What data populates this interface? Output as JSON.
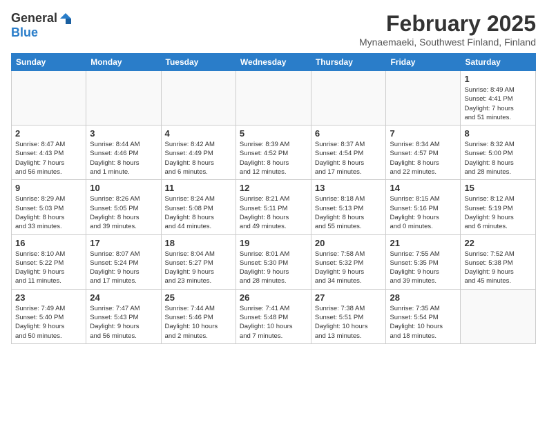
{
  "header": {
    "logo_general": "General",
    "logo_blue": "Blue",
    "month_title": "February 2025",
    "location": "Mynaemaeki, Southwest Finland, Finland"
  },
  "days_of_week": [
    "Sunday",
    "Monday",
    "Tuesday",
    "Wednesday",
    "Thursday",
    "Friday",
    "Saturday"
  ],
  "weeks": [
    [
      {
        "day": "",
        "detail": ""
      },
      {
        "day": "",
        "detail": ""
      },
      {
        "day": "",
        "detail": ""
      },
      {
        "day": "",
        "detail": ""
      },
      {
        "day": "",
        "detail": ""
      },
      {
        "day": "",
        "detail": ""
      },
      {
        "day": "1",
        "detail": "Sunrise: 8:49 AM\nSunset: 4:41 PM\nDaylight: 7 hours\nand 51 minutes."
      }
    ],
    [
      {
        "day": "2",
        "detail": "Sunrise: 8:47 AM\nSunset: 4:43 PM\nDaylight: 7 hours\nand 56 minutes."
      },
      {
        "day": "3",
        "detail": "Sunrise: 8:44 AM\nSunset: 4:46 PM\nDaylight: 8 hours\nand 1 minute."
      },
      {
        "day": "4",
        "detail": "Sunrise: 8:42 AM\nSunset: 4:49 PM\nDaylight: 8 hours\nand 6 minutes."
      },
      {
        "day": "5",
        "detail": "Sunrise: 8:39 AM\nSunset: 4:52 PM\nDaylight: 8 hours\nand 12 minutes."
      },
      {
        "day": "6",
        "detail": "Sunrise: 8:37 AM\nSunset: 4:54 PM\nDaylight: 8 hours\nand 17 minutes."
      },
      {
        "day": "7",
        "detail": "Sunrise: 8:34 AM\nSunset: 4:57 PM\nDaylight: 8 hours\nand 22 minutes."
      },
      {
        "day": "8",
        "detail": "Sunrise: 8:32 AM\nSunset: 5:00 PM\nDaylight: 8 hours\nand 28 minutes."
      }
    ],
    [
      {
        "day": "9",
        "detail": "Sunrise: 8:29 AM\nSunset: 5:03 PM\nDaylight: 8 hours\nand 33 minutes."
      },
      {
        "day": "10",
        "detail": "Sunrise: 8:26 AM\nSunset: 5:05 PM\nDaylight: 8 hours\nand 39 minutes."
      },
      {
        "day": "11",
        "detail": "Sunrise: 8:24 AM\nSunset: 5:08 PM\nDaylight: 8 hours\nand 44 minutes."
      },
      {
        "day": "12",
        "detail": "Sunrise: 8:21 AM\nSunset: 5:11 PM\nDaylight: 8 hours\nand 49 minutes."
      },
      {
        "day": "13",
        "detail": "Sunrise: 8:18 AM\nSunset: 5:13 PM\nDaylight: 8 hours\nand 55 minutes."
      },
      {
        "day": "14",
        "detail": "Sunrise: 8:15 AM\nSunset: 5:16 PM\nDaylight: 9 hours\nand 0 minutes."
      },
      {
        "day": "15",
        "detail": "Sunrise: 8:12 AM\nSunset: 5:19 PM\nDaylight: 9 hours\nand 6 minutes."
      }
    ],
    [
      {
        "day": "16",
        "detail": "Sunrise: 8:10 AM\nSunset: 5:22 PM\nDaylight: 9 hours\nand 11 minutes."
      },
      {
        "day": "17",
        "detail": "Sunrise: 8:07 AM\nSunset: 5:24 PM\nDaylight: 9 hours\nand 17 minutes."
      },
      {
        "day": "18",
        "detail": "Sunrise: 8:04 AM\nSunset: 5:27 PM\nDaylight: 9 hours\nand 23 minutes."
      },
      {
        "day": "19",
        "detail": "Sunrise: 8:01 AM\nSunset: 5:30 PM\nDaylight: 9 hours\nand 28 minutes."
      },
      {
        "day": "20",
        "detail": "Sunrise: 7:58 AM\nSunset: 5:32 PM\nDaylight: 9 hours\nand 34 minutes."
      },
      {
        "day": "21",
        "detail": "Sunrise: 7:55 AM\nSunset: 5:35 PM\nDaylight: 9 hours\nand 39 minutes."
      },
      {
        "day": "22",
        "detail": "Sunrise: 7:52 AM\nSunset: 5:38 PM\nDaylight: 9 hours\nand 45 minutes."
      }
    ],
    [
      {
        "day": "23",
        "detail": "Sunrise: 7:49 AM\nSunset: 5:40 PM\nDaylight: 9 hours\nand 50 minutes."
      },
      {
        "day": "24",
        "detail": "Sunrise: 7:47 AM\nSunset: 5:43 PM\nDaylight: 9 hours\nand 56 minutes."
      },
      {
        "day": "25",
        "detail": "Sunrise: 7:44 AM\nSunset: 5:46 PM\nDaylight: 10 hours\nand 2 minutes."
      },
      {
        "day": "26",
        "detail": "Sunrise: 7:41 AM\nSunset: 5:48 PM\nDaylight: 10 hours\nand 7 minutes."
      },
      {
        "day": "27",
        "detail": "Sunrise: 7:38 AM\nSunset: 5:51 PM\nDaylight: 10 hours\nand 13 minutes."
      },
      {
        "day": "28",
        "detail": "Sunrise: 7:35 AM\nSunset: 5:54 PM\nDaylight: 10 hours\nand 18 minutes."
      },
      {
        "day": "",
        "detail": ""
      }
    ]
  ]
}
